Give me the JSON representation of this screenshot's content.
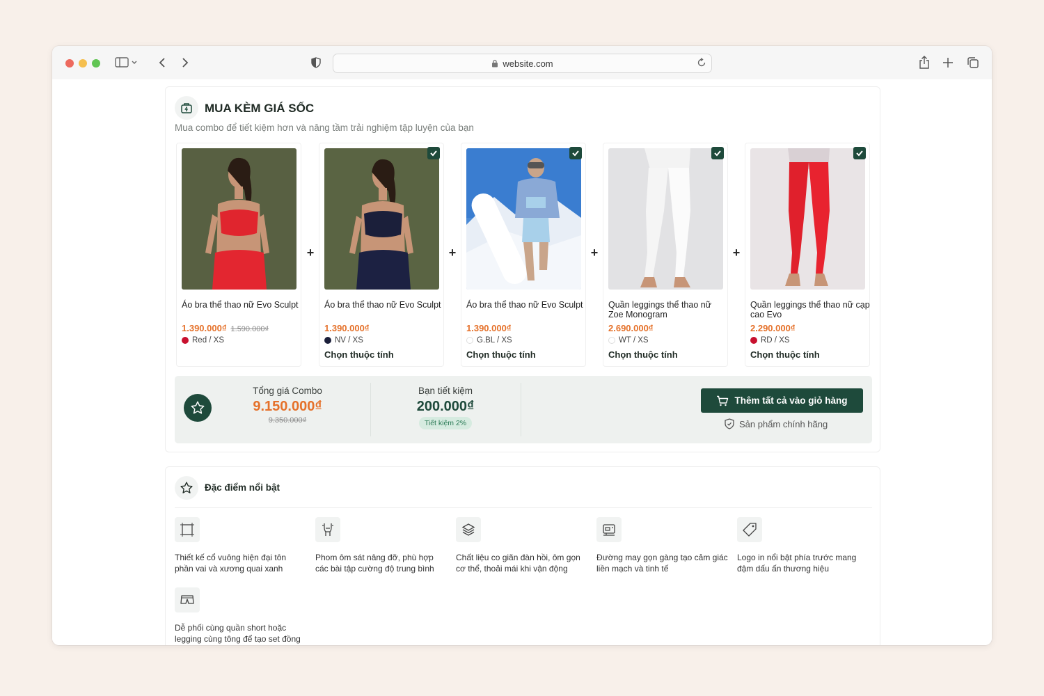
{
  "browser": {
    "url": "website.com"
  },
  "combo": {
    "title": "MUA KÈM GIÁ SỐC",
    "subtitle": "Mua combo để tiết kiệm hơn và nâng tầm trải nghiệm tập luyện của bạn",
    "plus_symbol": "+",
    "products": [
      {
        "name": "Áo bra thể thao nữ Evo Sculpt",
        "price": "1.390.000₫",
        "old_price": "1.590.000₫",
        "variant": "Red / XS",
        "swatch_color": "#c8102e",
        "checked": false,
        "choose_label": ""
      },
      {
        "name": "Áo bra thể thao nữ Evo Sculpt",
        "price": "1.390.000₫",
        "old_price": "",
        "variant": "NV / XS",
        "swatch_color": "#1b1f3a",
        "checked": true,
        "choose_label": "Chọn thuộc tính"
      },
      {
        "name": "Áo bra thể thao nữ Evo Sculpt",
        "price": "1.390.000₫",
        "old_price": "",
        "variant": "G.BL / XS",
        "swatch_color": "#ffffff",
        "checked": true,
        "choose_label": "Chọn thuộc tính"
      },
      {
        "name": "Quần leggings thể thao nữ Zoe Monogram",
        "price": "2.690.000₫",
        "old_price": "",
        "variant": "WT / XS",
        "swatch_color": "#ffffff",
        "checked": true,
        "choose_label": "Chọn thuộc tính"
      },
      {
        "name": "Quần leggings thể thao nữ cạp cao Evo",
        "price": "2.290.000₫",
        "old_price": "",
        "variant": "RD / XS",
        "swatch_color": "#c8102e",
        "checked": true,
        "choose_label": "Chọn thuộc tính"
      }
    ],
    "summary": {
      "total_label": "Tổng giá Combo",
      "total_price": "9.150.000₫",
      "total_old_price": "9.350.000₫",
      "save_label": "Bạn tiết kiệm",
      "save_amount": "200.000₫",
      "save_badge": "Tiết kiệm 2%",
      "cart_button": "Thêm tất cả vào giỏ hàng",
      "genuine_label": "Sản phẩm chính hãng"
    }
  },
  "features": {
    "title": "Đặc điểm nổi bật",
    "items": [
      {
        "icon": "frame-icon",
        "text": "Thiết kế cổ vuông hiện đại tôn phần vai và xương quai xanh"
      },
      {
        "icon": "body-fit-icon",
        "text": "Phom ôm sát nâng đỡ, phù hợp các bài tập cường độ trung bình"
      },
      {
        "icon": "layers-icon",
        "text": "Chất liệu co giãn đàn hồi, ôm gọn cơ thể, thoải mái khi vận động"
      },
      {
        "icon": "sewing-machine-icon",
        "text": "Đường may gọn gàng tạo cảm giác liền mạch và tinh tế"
      },
      {
        "icon": "tag-icon",
        "text": "Logo in nổi bật phía trước mang đậm dấu ấn thương hiệu"
      },
      {
        "icon": "shorts-icon",
        "text": "Dễ phối cùng quần short hoặc legging cùng tông để tạo set đồng bộ"
      }
    ]
  },
  "colors": {
    "accent": "#1e4a3b",
    "price": "#e5712a"
  }
}
